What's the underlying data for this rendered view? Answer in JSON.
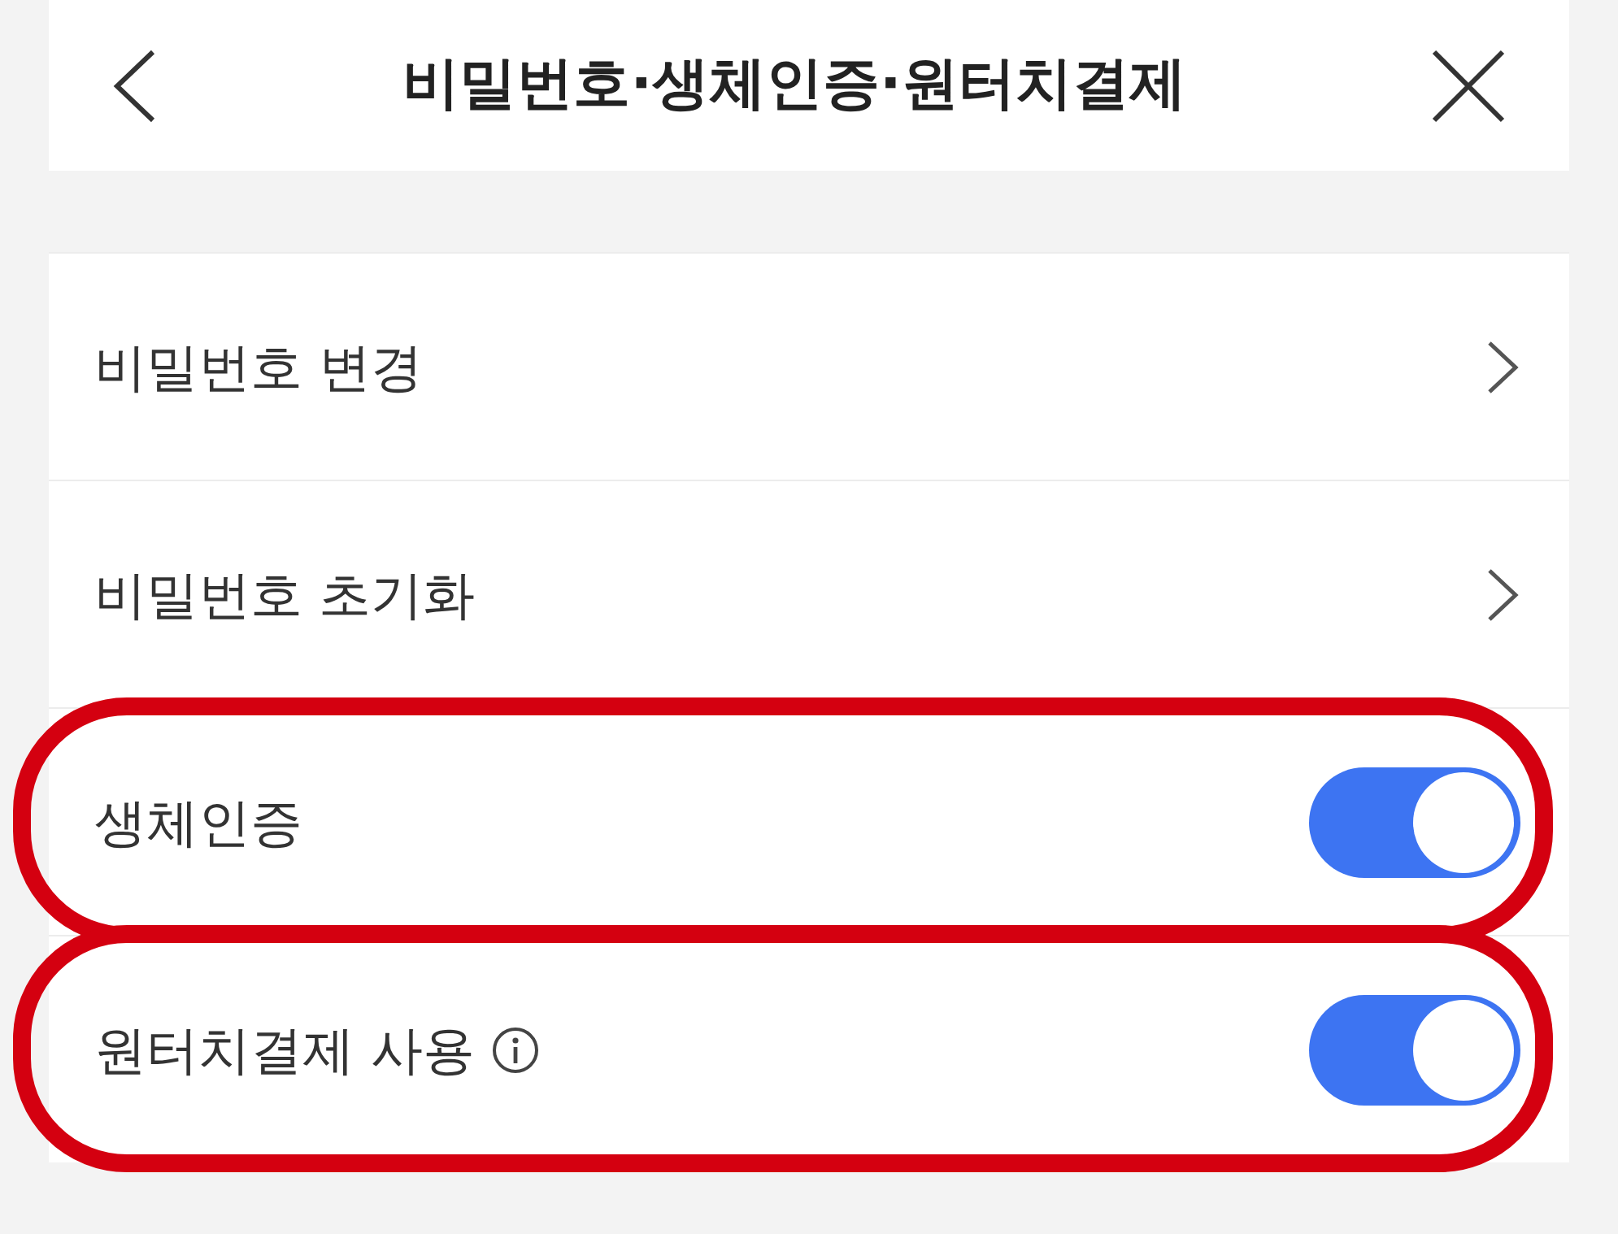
{
  "header": {
    "title": "비밀번호·생체인증·원터치결제"
  },
  "rows": [
    {
      "kind": "link",
      "label": "비밀번호 변경",
      "highlighted": false
    },
    {
      "kind": "link",
      "label": "비밀번호 초기화",
      "highlighted": false
    },
    {
      "kind": "toggle",
      "label": "생체인증",
      "on": true,
      "highlighted": true
    },
    {
      "kind": "toggle",
      "label": "원터치결제 사용",
      "info": true,
      "on": true,
      "highlighted": true
    }
  ]
}
